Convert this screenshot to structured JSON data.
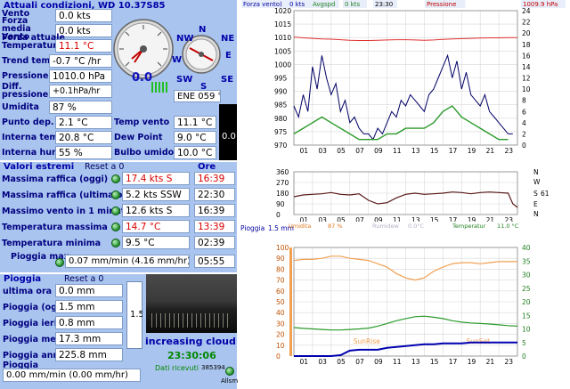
{
  "current": {
    "title": "Attuali condizioni, WD 10.37S85",
    "rows": [
      {
        "label": "Vento",
        "value": "0.0 kts"
      },
      {
        "label": "Forza media Vento",
        "value": "0.0 kts"
      },
      {
        "label": "Forza attuale",
        "value": ""
      },
      {
        "label": "Temperatura",
        "value": "11.1 °C"
      },
      {
        "label": "Trend temp",
        "value": "-0.7 °C /hr"
      },
      {
        "label": "Pressione",
        "value": "1010.0 hPa"
      },
      {
        "label": "Diff. pressione",
        "value": "+0.1hPa/hr"
      },
      {
        "label": "Umidita",
        "value": "87 %"
      },
      {
        "label": "Punto dep.",
        "value": "2.1 °C"
      },
      {
        "label": "Interna temp.",
        "value": "20.8 °C"
      },
      {
        "label": "Interna hum",
        "value": "55 %"
      }
    ],
    "gauge_value": "0.0",
    "compass": {
      "n": "N",
      "ne": "NE",
      "e": "E",
      "se": "SE",
      "s": "S",
      "sw": "SW",
      "w": "W",
      "nw": "NW"
    },
    "direction": "ENE  059 °",
    "right_rows": [
      {
        "label": "Temp vento",
        "value": "11.1 °C"
      },
      {
        "label": "Dew Point",
        "value": "9.0 °C"
      },
      {
        "label": "Bulbo umido",
        "value": "10.0 °C"
      }
    ],
    "bar_value": "0.0"
  },
  "extremes": {
    "title": "Valori estremi",
    "reset": "Reset a 0",
    "ore_header": "Ore",
    "rows": [
      {
        "label": "Massima raffica (oggi)",
        "value": "17.4 kts   S",
        "time": "16:39",
        "red": true
      },
      {
        "label": "Massima raffica (ultima ora)",
        "value": "5.2 kts SSW",
        "time": "22:30",
        "red": false
      },
      {
        "label": "Massimo vento in 1 minuto",
        "value": "12.6 kts   S",
        "time": "16:39",
        "red": false
      },
      {
        "label": "Temperatura massima",
        "value": "14.7 °C",
        "time": "13:39",
        "red": true
      },
      {
        "label": "Temperatura minima",
        "value": "9.5 °C",
        "time": "02:39",
        "red": false
      },
      {
        "label": "Pioggia max",
        "value": "0.07 mm/min (4.16 mm/hr)",
        "time": "05:55",
        "red": false
      }
    ]
  },
  "rain": {
    "title": "Pioggia",
    "reset": "Reset a 0",
    "rows": [
      {
        "label": "ultima ora",
        "value": "0.0 mm"
      },
      {
        "label": "Pioggia (oggi)",
        "value": "1.5 mm"
      },
      {
        "label": "Pioggia ieri",
        "value": "0.8 mm"
      },
      {
        "label": "Pioggia mese",
        "value": "17.3 mm"
      },
      {
        "label": "Pioggia anno",
        "value": "225.8 mm"
      },
      {
        "label": "Pioggia",
        "value": "0.00 mm/min (0.00 mm/hr)"
      }
    ],
    "gauge_label": "1.5"
  },
  "webcam": {
    "caption": "increasing cloud",
    "time": "23:30:06",
    "received_label": "Dati ricevuti",
    "counter": "385394",
    "alarm_label": "Allsm"
  },
  "chart_data": [
    {
      "type": "line",
      "title": "",
      "legend": [
        "Forza vento)",
        "0 kts",
        "Avgspd",
        "0 kts",
        "23:30",
        "Pressione",
        "1009.9 hPa"
      ],
      "x_ticks": [
        "01",
        "03",
        "05",
        "07",
        "09",
        "11",
        "13",
        "15",
        "17",
        "19",
        "21",
        "23"
      ],
      "y_left_ticks": [
        970,
        975,
        980,
        985,
        990,
        995,
        1000,
        1005,
        1010,
        1015,
        1020
      ],
      "y_right_ticks": [
        0,
        2,
        4,
        6,
        8,
        10,
        12,
        14,
        16,
        18,
        20,
        22,
        24
      ],
      "ylim_left": [
        970,
        1020
      ],
      "ylim_right": [
        0,
        24
      ],
      "series": [
        {
          "name": "Pressione",
          "color": "#e03030",
          "axis": "left",
          "x": [
            0,
            1,
            2,
            3,
            4,
            5,
            6,
            7,
            8,
            9,
            10,
            11,
            12,
            13,
            14,
            15,
            16,
            17,
            18,
            19,
            20,
            21,
            22,
            23,
            24
          ],
          "values": [
            1010.2,
            1009.9,
            1009.7,
            1009.5,
            1009.4,
            1009.2,
            1009.0,
            1008.9,
            1008.9,
            1009.0,
            1009.1,
            1009.2,
            1009.2,
            1009.1,
            1009.0,
            1009.1,
            1009.3,
            1009.5,
            1009.6,
            1009.7,
            1009.8,
            1009.9,
            1009.9,
            1010.0,
            1010.0
          ]
        },
        {
          "name": "Forza vento)",
          "color": "#000066",
          "axis": "right",
          "x": [
            0,
            0.5,
            1,
            1.5,
            2,
            2.5,
            3,
            3.5,
            4,
            4.5,
            5,
            5.5,
            6,
            6.5,
            7,
            7.5,
            8,
            8.5,
            9,
            9.5,
            10,
            10.5,
            11,
            11.5,
            12,
            12.5,
            13,
            13.5,
            14,
            14.5,
            15,
            15.5,
            16,
            16.5,
            17,
            17.5,
            18,
            18.5,
            19,
            19.5,
            20,
            20.5,
            21,
            21.5,
            22,
            22.5,
            23,
            23.5
          ],
          "values": [
            7,
            5,
            9,
            6,
            14,
            10,
            16,
            12,
            9,
            11,
            6,
            8,
            4,
            5,
            3,
            2,
            2,
            1,
            3,
            2,
            4,
            6,
            5,
            8,
            7,
            9,
            8,
            7,
            6,
            9,
            10,
            12,
            14,
            16,
            12,
            15,
            10,
            13,
            9,
            8,
            7,
            9,
            6,
            5,
            4,
            3,
            2,
            2
          ]
        },
        {
          "name": "Avgspd",
          "color": "#2a9a2a",
          "axis": "right",
          "x": [
            0,
            1,
            2,
            3,
            4,
            5,
            6,
            7,
            8,
            9,
            10,
            11,
            12,
            13,
            14,
            15,
            16,
            17,
            18,
            19,
            20,
            21,
            22,
            23
          ],
          "values": [
            2,
            3,
            4,
            5,
            4,
            3,
            2,
            1,
            1,
            1,
            2,
            2,
            3,
            3,
            3,
            4,
            6,
            7,
            5,
            4,
            3,
            2,
            1,
            1
          ]
        }
      ]
    },
    {
      "type": "line",
      "title": "",
      "legend_right": [
        "N",
        "W",
        "S",
        "61",
        "E",
        "N"
      ],
      "x_ticks": [
        "01",
        "03",
        "05",
        "07",
        "09",
        "11",
        "13",
        "15",
        "17",
        "19",
        "21",
        "23"
      ],
      "y_ticks": [
        0,
        90,
        180,
        270,
        360
      ],
      "ylim": [
        0,
        360
      ],
      "series": [
        {
          "name": "direction",
          "color": "#5a1a1a",
          "x": [
            0,
            1,
            2,
            3,
            4,
            5,
            6,
            7,
            8,
            9,
            10,
            11,
            12,
            13,
            14,
            15,
            16,
            17,
            18,
            19,
            20,
            21,
            22,
            23,
            23.5,
            24
          ],
          "values": [
            150,
            165,
            170,
            175,
            185,
            170,
            165,
            175,
            120,
            90,
            100,
            140,
            170,
            180,
            170,
            175,
            180,
            190,
            185,
            175,
            185,
            190,
            185,
            180,
            90,
            60
          ]
        }
      ]
    },
    {
      "type": "line",
      "title": "",
      "legend": [
        "Umidita",
        "87 %",
        "Rumidew",
        "0.0°C",
        "Temperatur",
        "11.0 °C"
      ],
      "left_label": "Pioggia",
      "left_unit": "1.5 mm",
      "x_ticks": [
        "01",
        "03",
        "05",
        "07",
        "09",
        "11",
        "13",
        "15",
        "17",
        "19",
        "21",
        "23"
      ],
      "y_left_ticks": [
        0,
        10,
        20,
        30,
        40,
        50,
        60,
        70,
        80,
        90,
        100
      ],
      "y_right_ticks": [
        0,
        5,
        10,
        15,
        20,
        25,
        30,
        35,
        40
      ],
      "ylim_left": [
        0,
        100
      ],
      "ylim_right": [
        0,
        40
      ],
      "annotations": [
        "SunRise",
        "SunSet"
      ],
      "series": [
        {
          "name": "Umidita",
          "color": "#f0a050",
          "axis": "left",
          "x": [
            0,
            1,
            2,
            3,
            4,
            5,
            6,
            7,
            8,
            9,
            10,
            11,
            12,
            13,
            14,
            15,
            16,
            17,
            18,
            19,
            20,
            21,
            22,
            23,
            24
          ],
          "values": [
            88,
            89,
            89,
            90,
            92,
            92,
            90,
            89,
            88,
            85,
            82,
            76,
            72,
            70,
            72,
            78,
            82,
            85,
            86,
            86,
            85,
            86,
            87,
            87,
            87
          ]
        },
        {
          "name": "Temperatur",
          "color": "#2a9a2a",
          "axis": "right",
          "x": [
            0,
            1,
            2,
            3,
            4,
            5,
            6,
            7,
            8,
            9,
            10,
            11,
            12,
            13,
            14,
            15,
            16,
            17,
            18,
            19,
            20,
            21,
            22,
            23,
            24
          ],
          "values": [
            10.5,
            10.2,
            10.0,
            9.8,
            9.6,
            9.6,
            9.8,
            10.0,
            10.3,
            11.0,
            12.0,
            13.0,
            13.8,
            14.5,
            14.7,
            14.3,
            13.8,
            13.0,
            12.5,
            12.2,
            12.0,
            11.8,
            11.5,
            11.2,
            11.0
          ]
        },
        {
          "name": "Pioggia",
          "color": "#0000b0",
          "axis": "rain",
          "x": [
            0,
            1,
            2,
            3,
            4,
            5,
            6,
            7,
            8,
            9,
            10,
            11,
            12,
            13,
            14,
            15,
            16,
            17,
            18,
            19,
            20,
            21,
            22,
            23,
            24
          ],
          "values": [
            0,
            0,
            0,
            0,
            0,
            0.1,
            0.6,
            0.7,
            0.7,
            0.7,
            0.9,
            1.0,
            1.1,
            1.2,
            1.3,
            1.3,
            1.4,
            1.4,
            1.4,
            1.5,
            1.5,
            1.5,
            1.5,
            1.5,
            1.5
          ]
        }
      ]
    }
  ]
}
